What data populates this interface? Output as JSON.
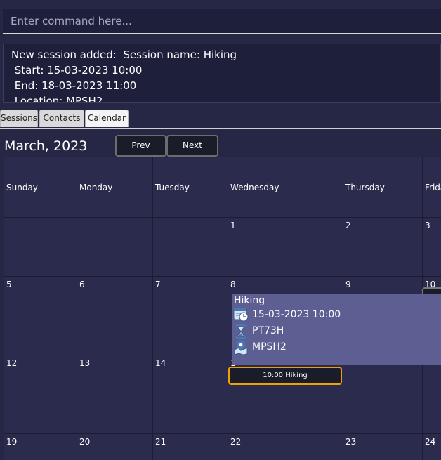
{
  "command": {
    "placeholder": "Enter command here..."
  },
  "result": {
    "text": "New session added:  Session name: Hiking\n Start: 15-03-2023 10:00\n End: 18-03-2023 11:00\n Location: MPSH2"
  },
  "tabs": [
    {
      "label": "Sessions"
    },
    {
      "label": "Contacts"
    },
    {
      "label": "Calendar",
      "active": true
    }
  ],
  "calendar": {
    "month_title": "March, 2023",
    "prev_label": "Prev",
    "next_label": "Next",
    "weekdays": [
      "Sunday",
      "Monday",
      "Tuesday",
      "Wednesday",
      "Thursday",
      "Frida"
    ],
    "weeks": [
      [
        "",
        "",
        "",
        "1",
        "2",
        "3"
      ],
      [
        "5",
        "6",
        "7",
        "8",
        "9",
        "10"
      ],
      [
        "12",
        "13",
        "14",
        "1",
        "",
        ""
      ],
      [
        "19",
        "20",
        "21",
        "22",
        "23",
        "24"
      ]
    ],
    "event": {
      "label": "10:00 Hiking"
    },
    "tooltip": {
      "title": "Hiking",
      "start": "15-03-2023 10:00",
      "duration": "PT73H",
      "location": "MPSH2",
      "icons": [
        "calendar-clock-icon",
        "hourglass-icon",
        "location-pin-icon"
      ]
    }
  },
  "colors": {
    "background": "#262745",
    "cell": "#2b2c4d",
    "tooltip": "#5d5f92",
    "event_border": "#f0a000"
  }
}
